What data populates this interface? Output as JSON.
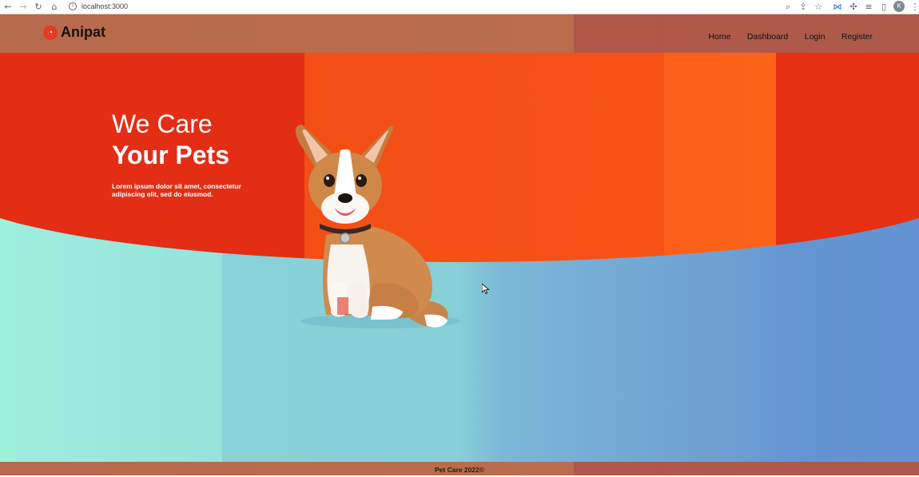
{
  "browser": {
    "url": "localhost:3000",
    "profile_initial": "K",
    "icons": [
      "back-icon",
      "forward-icon",
      "reload-icon",
      "home-icon",
      "site-info-icon",
      "zoom-icon",
      "share-icon",
      "bookmark-star-icon",
      "extension-icon",
      "puzzle-icon",
      "reading-list-icon",
      "side-panel-icon",
      "menu-dots-icon"
    ]
  },
  "navbar": {
    "brand": "Anipat",
    "links": [
      {
        "label": "Home"
      },
      {
        "label": "Dashboard"
      },
      {
        "label": "Login"
      },
      {
        "label": "Register"
      }
    ]
  },
  "hero": {
    "heading_line1": "We Care",
    "heading_line2": "Your Pets",
    "description": "Lorem ipsum dolor sit amet, consectetur adipiscing elit, sed do eiusmod.",
    "image": "corgi-dog-illustration"
  },
  "footer": {
    "text": "Pet Care 2022©"
  },
  "colors": {
    "hero_red": "#e32e15",
    "hero_orange": "#f65218",
    "band_teal": "#9ef2dc",
    "band_blue": "#6292d2",
    "navbar_brown": "#b86a4c",
    "brand_mark": "#e63a1f"
  }
}
